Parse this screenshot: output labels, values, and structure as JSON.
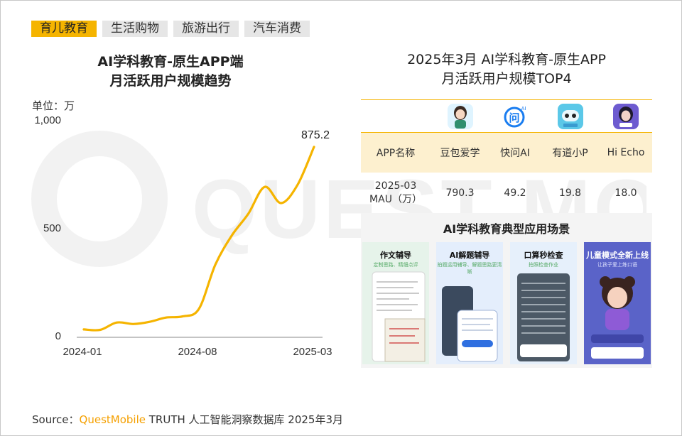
{
  "tabs": [
    {
      "label": "育儿教育",
      "active": true
    },
    {
      "label": "生活购物",
      "active": false
    },
    {
      "label": "旅游出行",
      "active": false
    },
    {
      "label": "汽车消费",
      "active": false
    }
  ],
  "left_title_line1": "AI学科教育-原生APP端",
  "left_title_line2": "月活跃用户规模趋势",
  "unit_label": "单位：万",
  "chart_data": {
    "type": "line",
    "title": "AI学科教育-原生APP端 月活跃用户规模趋势",
    "ylabel": "单位：万",
    "ylim": [
      0,
      1000
    ],
    "yticks": [
      "0",
      "500",
      "1,000"
    ],
    "xticks": [
      "2024-01",
      "2024-08",
      "2025-03"
    ],
    "x": [
      "2024-01",
      "2024-02",
      "2024-03",
      "2024-04",
      "2024-05",
      "2024-06",
      "2024-07",
      "2024-08",
      "2024-09",
      "2024-10",
      "2024-11",
      "2024-12",
      "2025-01",
      "2025-02",
      "2025-03"
    ],
    "series": [
      {
        "values": [
          30,
          28,
          62,
          55,
          65,
          85,
          90,
          125,
          330,
          465,
          565,
          690,
          615,
          700,
          875.2
        ],
        "color": "#f5b400"
      }
    ],
    "annotations": [
      {
        "index": 14,
        "text": "875.2"
      }
    ],
    "grid": false
  },
  "right_title_line1": "2025年3月 AI学科教育-原生APP",
  "right_title_line2": "月活跃用户规模TOP4",
  "table": {
    "header_label": "APP名称",
    "row_label_line1": "2025-03",
    "row_label_line2": "MAU（万）",
    "apps": [
      {
        "name": "豆包爱学",
        "mau": "790.3",
        "icon": "doubao-aixue-icon",
        "color": "#dff4ff"
      },
      {
        "name": "快问AI",
        "mau": "49.2",
        "icon": "kuaiwen-ai-icon",
        "color": "#1a7df0"
      },
      {
        "name": "有道小P",
        "mau": "19.8",
        "icon": "youdao-xiaop-icon",
        "color": "#5bc8e8"
      },
      {
        "name": "Hi Echo",
        "mau": "18.0",
        "icon": "hi-echo-icon",
        "color": "#6d5bd0"
      }
    ]
  },
  "scene": {
    "title": "AI学科教育典型应用场景",
    "cards": [
      {
        "label": "作文辅导",
        "sub": "定制思路、精细点评",
        "bg": "#e6f3ea"
      },
      {
        "label": "AI解题辅导",
        "sub": "拍题运用辅导、解题思路更清晰",
        "bg": "#e4eefc"
      },
      {
        "label": "口算秒检查",
        "sub": "拍照检查作业",
        "bg": "#e6f0fb"
      },
      {
        "label": "儿童模式全新上线",
        "sub": "让孩子爱上练口语",
        "bg": "#5a63c8"
      }
    ]
  },
  "watermark": "QUESTMOBILE",
  "source": {
    "prefix": "Source：",
    "brand": "QuestMobile",
    "suffix": " TRUTH 人工智能洞察数据库 2025年3月"
  }
}
